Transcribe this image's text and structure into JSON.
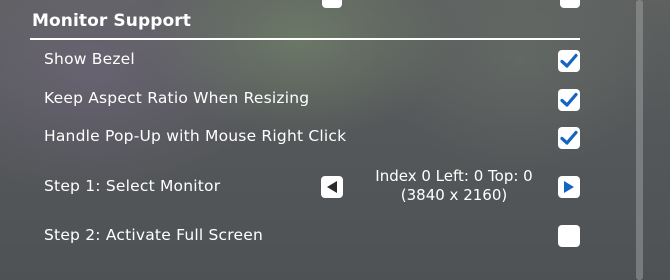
{
  "section": {
    "title": "Monitor Support"
  },
  "rows": [
    {
      "label": "Show Bezel",
      "checked": true
    },
    {
      "label": "Keep Aspect Ratio When Resizing",
      "checked": true
    },
    {
      "label": "Handle Pop-Up with Mouse Right Click",
      "checked": true
    },
    {
      "label": "Step 1: Select Monitor"
    },
    {
      "label": "Step 2: Activate Full Screen",
      "checked": false
    }
  ],
  "monitor": {
    "line1": "Index 0  Left: 0 Top: 0",
    "line2": "(3840 x 2160)"
  },
  "icons": {
    "check": "check-icon",
    "prev": "triangle-left-icon",
    "next": "triangle-right-icon"
  },
  "colors": {
    "accent": "#1565c0",
    "arrow_dark": "#2b2b2b"
  }
}
